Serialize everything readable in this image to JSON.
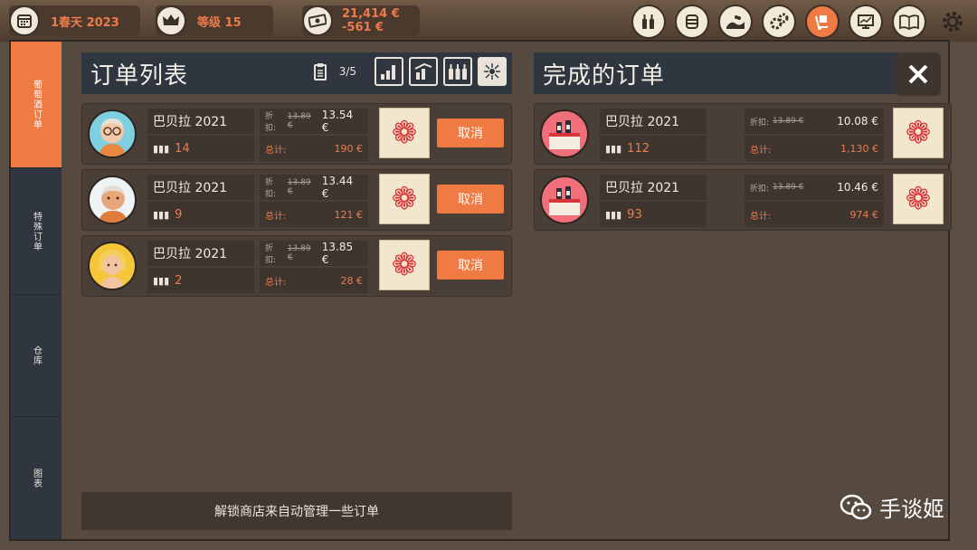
{
  "topbar": {
    "date": "1春天 2023",
    "level": "等级 15",
    "balance": "21,414 €",
    "change": "-561 €",
    "tools": [
      {
        "icon": "bottles-icon",
        "active": false
      },
      {
        "icon": "barrel-icon",
        "active": false
      },
      {
        "icon": "vineyard-icon",
        "active": false
      },
      {
        "icon": "gears-icon",
        "active": false
      },
      {
        "icon": "delivery-icon",
        "active": true
      },
      {
        "icon": "monitor-chart-icon",
        "active": false
      },
      {
        "icon": "book-icon",
        "active": false
      },
      {
        "icon": "settings-icon",
        "active": false
      }
    ]
  },
  "sidebar": {
    "tabs": [
      {
        "label": "葡萄酒订单",
        "active": true
      },
      {
        "label": "特殊订单",
        "active": false
      },
      {
        "label": "仓库",
        "active": false
      },
      {
        "label": "图表",
        "active": false
      }
    ]
  },
  "order_list": {
    "title": "订单列表",
    "count": "3/5",
    "orders": [
      {
        "wine": "巴贝拉 2021",
        "qty": "14",
        "discount_label": "折扣:",
        "old_price": "13.89 €",
        "new_price": "13.54 €",
        "total_label": "总计:",
        "total": "190 €",
        "cancel": "取消",
        "avatar": "old-man-glasses"
      },
      {
        "wine": "巴贝拉 2021",
        "qty": "9",
        "discount_label": "折扣:",
        "old_price": "13.89 €",
        "new_price": "13.44 €",
        "total_label": "总计:",
        "total": "121 €",
        "cancel": "取消",
        "avatar": "bald-man"
      },
      {
        "wine": "巴贝拉 2021",
        "qty": "2",
        "discount_label": "折扣:",
        "old_price": "13.89 €",
        "new_price": "13.85 €",
        "total_label": "总计:",
        "total": "28 €",
        "cancel": "取消",
        "avatar": "blonde-woman"
      }
    ]
  },
  "completed": {
    "title": "完成的订单",
    "orders": [
      {
        "wine": "巴贝拉 2021",
        "qty": "112",
        "discount_label": "折扣:",
        "old_price": "13.89 €",
        "new_price": "10.08 €",
        "total_label": "总计:",
        "total": "1,130 €",
        "avatar": "wine-shop"
      },
      {
        "wine": "巴贝拉 2021",
        "qty": "93",
        "discount_label": "折扣:",
        "old_price": "13.89 €",
        "new_price": "10.46 €",
        "total_label": "总计:",
        "total": "974 €",
        "avatar": "wine-shop"
      }
    ]
  },
  "unlock_text": "解锁商店来自动管理一些订单",
  "watermark": "手谈姬",
  "colors": {
    "accent": "#f07a44",
    "panel": "#554940",
    "header": "#2f3640",
    "flower": "#d8353a"
  }
}
